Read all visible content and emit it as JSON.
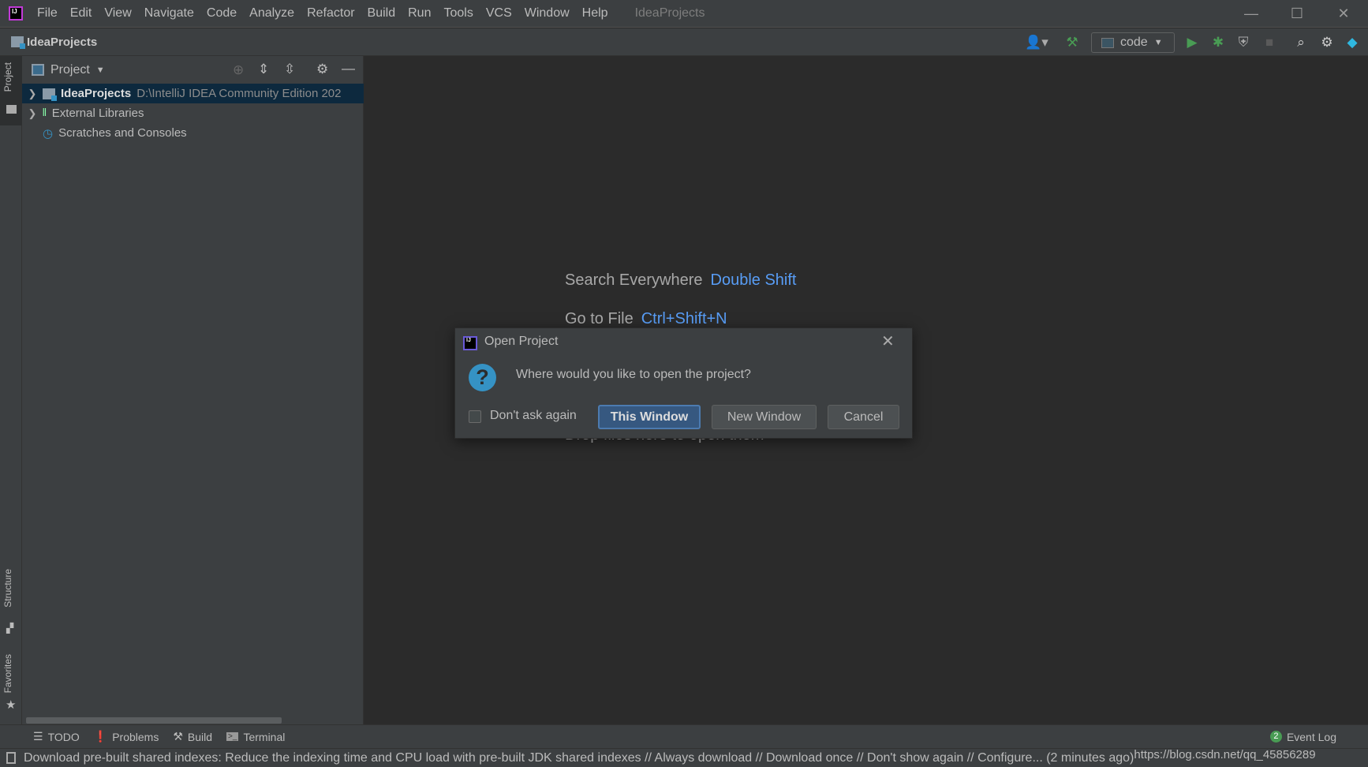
{
  "window": {
    "title": "IdeaProjects",
    "logo_text": "IJ"
  },
  "menu": [
    "File",
    "Edit",
    "View",
    "Navigate",
    "Code",
    "Analyze",
    "Refactor",
    "Build",
    "Run",
    "Tools",
    "VCS",
    "Window",
    "Help"
  ],
  "navbar": {
    "project": "IdeaProjects",
    "run_config": "code"
  },
  "side_tabs": {
    "project": "Project",
    "structure": "Structure",
    "favorites": "Favorites"
  },
  "project_panel": {
    "view": "Project",
    "tree": [
      {
        "label": "IdeaProjects",
        "path": "D:\\IntelliJ IDEA Community Edition 202",
        "selected": true
      },
      {
        "label": "External Libraries"
      },
      {
        "label": "Scratches and Consoles"
      }
    ]
  },
  "editor_hints": [
    {
      "label": "Search Everywhere",
      "key": "Double Shift"
    },
    {
      "label": "Go to File",
      "key": "Ctrl+Shift+N"
    },
    {
      "label": "Drop files here to open them",
      "key": ""
    }
  ],
  "dialog": {
    "title": "Open Project",
    "message": "Where would you like to open the project?",
    "checkbox_label": "Don't ask again",
    "checkbox_checked": false,
    "buttons": {
      "this_window": "This Window",
      "new_window": "New Window",
      "cancel": "Cancel"
    }
  },
  "tool_windows": [
    "TODO",
    "Problems",
    "Build",
    "Terminal"
  ],
  "event_log": {
    "label": "Event Log",
    "count": "2"
  },
  "status": {
    "message": "Download pre-built shared indexes: Reduce the indexing time and CPU load with pre-built JDK shared indexes // Always download // Download once // Don't show again // Configure... (2 minutes ago)",
    "watermark": "https://blog.csdn.net/qq_45856289"
  },
  "colors": {
    "accent": "#589df6",
    "run": "#499c54",
    "selection": "#0d293e",
    "default_button": "#365880"
  }
}
